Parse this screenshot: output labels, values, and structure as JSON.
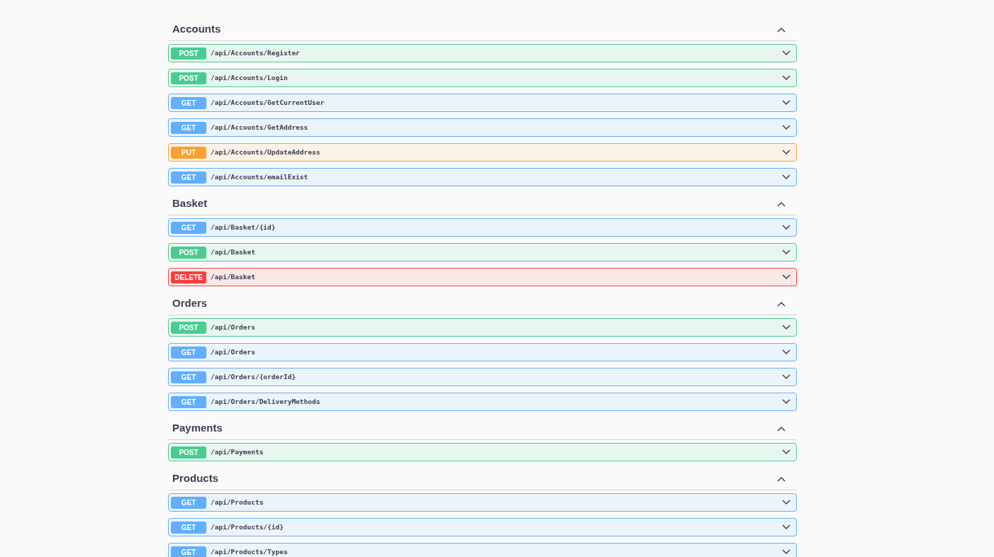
{
  "sections": [
    {
      "name": "Accounts",
      "expanded": true,
      "operations": [
        {
          "method": "POST",
          "kind": "post",
          "path": "/api/Accounts/Register",
          "expanded": false
        },
        {
          "method": "POST",
          "kind": "post",
          "path": "/api/Accounts/Login",
          "expanded": false
        },
        {
          "method": "GET",
          "kind": "get",
          "path": "/api/Accounts/GetCurrentUser",
          "expanded": false
        },
        {
          "method": "GET",
          "kind": "get",
          "path": "/api/Accounts/GetAddress",
          "expanded": false
        },
        {
          "method": "PUT",
          "kind": "put",
          "path": "/api/Accounts/UpdateAddress",
          "expanded": false
        },
        {
          "method": "GET",
          "kind": "get",
          "path": "/api/Accounts/emailExist",
          "expanded": false
        }
      ]
    },
    {
      "name": "Basket",
      "expanded": true,
      "operations": [
        {
          "method": "GET",
          "kind": "get",
          "path": "/api/Basket/{id}",
          "expanded": false
        },
        {
          "method": "POST",
          "kind": "post",
          "path": "/api/Basket",
          "expanded": false
        },
        {
          "method": "DELETE",
          "kind": "delete",
          "path": "/api/Basket",
          "expanded": false
        }
      ]
    },
    {
      "name": "Orders",
      "expanded": true,
      "operations": [
        {
          "method": "POST",
          "kind": "post",
          "path": "/api/Orders",
          "expanded": false
        },
        {
          "method": "GET",
          "kind": "get",
          "path": "/api/Orders",
          "expanded": false
        },
        {
          "method": "GET",
          "kind": "get",
          "path": "/api/Orders/{orderId}",
          "expanded": false
        },
        {
          "method": "GET",
          "kind": "get",
          "path": "/api/Orders/DeliveryMethods",
          "expanded": false
        }
      ]
    },
    {
      "name": "Payments",
      "expanded": true,
      "operations": [
        {
          "method": "POST",
          "kind": "post",
          "path": "/api/Payments",
          "expanded": false
        }
      ]
    },
    {
      "name": "Products",
      "expanded": true,
      "operations": [
        {
          "method": "GET",
          "kind": "get",
          "path": "/api/Products",
          "expanded": false
        },
        {
          "method": "GET",
          "kind": "get",
          "path": "/api/Products/{id}",
          "expanded": false
        },
        {
          "method": "GET",
          "kind": "get",
          "path": "/api/Products/Types",
          "expanded": false
        }
      ]
    }
  ]
}
